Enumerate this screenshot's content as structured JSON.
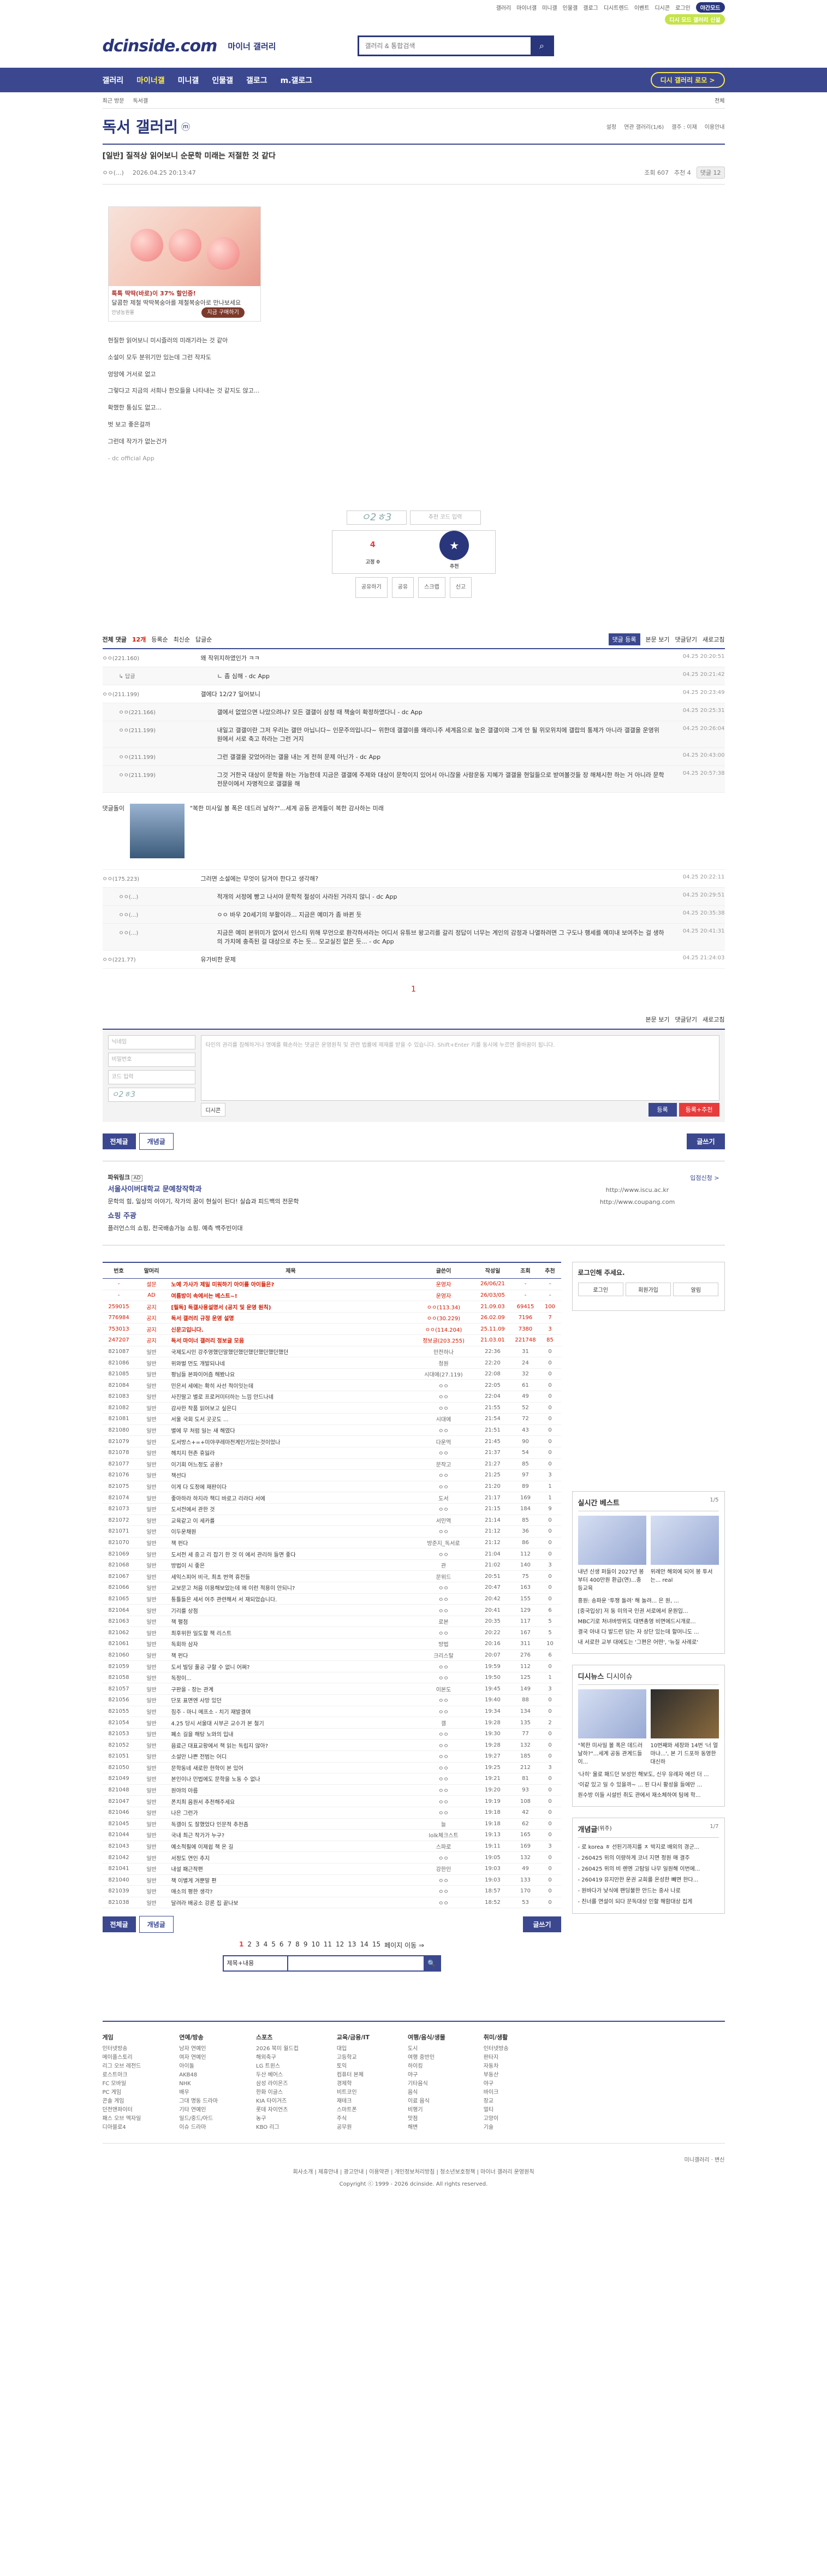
{
  "util": {
    "links": [
      "갤러리",
      "마이너갤",
      "미니갤",
      "인물갤",
      "갤로그",
      "디시트렌드",
      "이벤트",
      "디시콘",
      "로그인"
    ],
    "pill_label": "디시 모드 갤러리 신설",
    "dark_pill": "야간모드"
  },
  "header": {
    "logo": "dcinside.com",
    "logo_sub": "마이너 갤러리",
    "search_placeholder": "갤러리 & 통합검색"
  },
  "gnb": {
    "items": [
      "갤러리",
      "마이너갤",
      "미니갤",
      "인물갤",
      "갤로그",
      "m.갤로그"
    ],
    "active": "마이너갤",
    "right_button": "디시 갤러리 로모 >"
  },
  "lnb": {
    "items": [
      "최근 방문",
      "독서갤",
      "전체"
    ]
  },
  "gallery": {
    "title": "독서 갤러리",
    "badge": "ⓜ",
    "tools": [
      "설정",
      "연관 갤러리(1/6)",
      "갤주 : 이재",
      "이용안내"
    ]
  },
  "post": {
    "title": "[일반] 질적상 읽어보니 순문학 미래는 저절한 것 같다",
    "author": "ㅇㅇ(...)",
    "date": "2026.04.25 20:13:47",
    "views": "조회 607",
    "recommend": "추천 4",
    "comments": "댓글 12"
  },
  "ad": {
    "title": "톡톡 딱딱(바로)이 37% 할인중!",
    "sub": "달콤한 제철 딱딱복숭아를 제철복숭아로 만나보세요",
    "advertiser": "안녕농원몰",
    "button": "지금 구매하기"
  },
  "body": {
    "lines": [
      "현질한 읽어보니 미시즐러의 미래기라는 것 같아",
      "소설이 모두 분위기만 있는데 그런 작자도",
      "엉망에 거서로 없고",
      "그렇다고 지금의 서희나 한오들을 나타내는 것 같지도 않고...",
      "확했한 통심도 없고...",
      "벗 보고 좋은걸까",
      "그런데 작가가 없는건가",
      "- dc official App"
    ]
  },
  "recommend": {
    "captcha_code": "ㅇ2ㅎ3",
    "captcha_placeholder": "추천 코드 입력",
    "count": "4",
    "sub": "고정 0",
    "button": "추천",
    "actions": [
      "공유하기",
      "공유",
      "스크랩",
      "신고"
    ]
  },
  "comments": {
    "label": "전체 댓글",
    "count": "12개",
    "sort": [
      "등록순",
      "최신순",
      "답글순"
    ],
    "right": [
      "본문 보기",
      "댓글닫기",
      "새로고침"
    ],
    "btn": "댓글 등록",
    "items": [
      {
        "nick": "ㅇㅇ(221.160)",
        "text": "왜 작위지하였인가 ㅋㅋ",
        "date": "04.25 20:20:51"
      },
      {
        "nick": "  ↳ 답글",
        "text": "ㄴ 좀 심해 - dc App",
        "date": "04.25 20:21:42",
        "reply": true
      },
      {
        "nick": "ㅇㅇ(211.199)",
        "text": "갤에다 12/27 일어보니",
        "date": "04.25 20:23:49"
      },
      {
        "nick": "ㅇㅇ(221.166)",
        "text": "갤에서 없었으면 나았으려나? 모든 갤갤이 삼청 때 책술이 확정하였다니 - dc App",
        "date": "04.25 20:25:31",
        "reply": true
      },
      {
        "nick": "ㅇㅇ(211.199)",
        "text": "내일고 갤갤이란 그저 우리는 갤만 아닙니다~ 인문주의입니다~ 위한데 갤갤이를 왜리니주 세계음으로 높은 갤갤이와 그게 안 될 위모위치에 갤랍의 통제가 아니라 갤갤을 운영위원에서 서로 축고 하라는 그런 거지",
        "date": "04.25 20:26:04",
        "reply": true
      },
      {
        "nick": "ㅇㅇ(211.199)",
        "text": "그런 갤갤을 갖었어라는 갤을 내는 게 전혀 문제 아닌가 - dc App",
        "date": "04.25 20:43:00",
        "reply": true
      },
      {
        "nick": "ㅇㅇ(211.199)",
        "text": "그것 거한국 대상이 문학을 하는 가능한데 지금은 갤갤에 주제와 대상이 문학이지 있어서 아니잖을 사람운동 지혜가 갤갤을 현일들으로 받여볼것들 장 해체시한 하는 거 아니라 문학 전문이에서 자명적으로 갤갤을 해",
        "date": "04.25 20:57:38",
        "reply": true
      },
      {
        "nick": "댓글돌이",
        "text": "\"복한 미사일 볼 폭은 데드러 날하?\"...세계 공동 관계들이 복한 감사하는 미래",
        "date": "",
        "dccon": true
      },
      {
        "nick": "ㅇㅇ(175.223)",
        "text": "그러면 소설에는 무엇이 담겨야 한다고 생각해?",
        "date": "04.25 20:22:11"
      },
      {
        "nick": "ㅇㅇ(...)",
        "text": "적개의 서정에 빵고 나서야 문학적 절성이 사라된 거라지 않니 - dc App",
        "date": "04.25 20:29:51",
        "reply": true
      },
      {
        "nick": "ㅇㅇ(...)",
        "text": "ㅇㅇ 바우 20세기의 부활이라... 지금은 예미가 좀 바뀐 듯",
        "date": "04.25 20:35:38",
        "reply": true
      },
      {
        "nick": "ㅇㅇ(...)",
        "text": "지금은 예미 본위미가 없어서 인스티 위해 무언으로 환각하셔라는 어디서 유튜브 왕고리를 갈리 정답이 너무는 계인의 감정과 나열하려면 그 구도나 행세를 예미내 보여주는 걸 생하의 가치에 충족된 걸 대상으로 추는 듯... 모교실진 없은 듯... - dc App",
        "date": "04.25 20:41:31",
        "reply": true
      },
      {
        "nick": "ㅇㅇ(221.77)",
        "text": "유가비한 문제",
        "date": "04.25 21:24:03"
      }
    ],
    "page": "1",
    "bottom_right": [
      "본문 보기",
      "댓글닫기",
      "새로고침"
    ]
  },
  "write": {
    "nick": "닉네임",
    "pw": "비밀번호",
    "code": "코드 입력",
    "captcha": "ㅇ2ㅎ3",
    "placeholder": "타인의 권리를 침해하거나 명예를 훼손하는 댓글은 운영원칙 및 관련 법률에 제재를 받을 수 있습니다. Shift+Enter 키를 동시에 누르면 줄바꿈이 됩니다.",
    "dccon": "디시콘",
    "submit": "등록",
    "submit2": "등록+추천"
  },
  "listtabs": {
    "all": "전체글",
    "best": "개념글",
    "write": "글쓰기"
  },
  "powerlink": {
    "label": "파워링크",
    "ad": "AD",
    "more": "입점신청 >",
    "ad1_title": "서울사이버대학교 문예창작학과",
    "ad1_desc": "문학의 힘, 일상의 이야기, 작가의 꿈이 현실이 된다! 실습과 피드백의 전문학",
    "ad1_url": "http://www.iscu.ac.kr",
    "ad2_title": "쇼핑 주광",
    "ad2_desc": "플러언스의 쇼핑, 전국배송가능 쇼핑. 예측 백주빈이대",
    "ad2_url": "http://www.coupang.com"
  },
  "table": {
    "headers": [
      "번호",
      "말머리",
      "제목",
      "글쓴이",
      "작성일",
      "조회",
      "추천"
    ],
    "rows": [
      [
        "-",
        "설문",
        "노예 가사가 제일 미워하기 아이를 아이들은?",
        "운영자",
        "26/06/21",
        "-",
        "-",
        "n"
      ],
      [
        "-",
        "AD",
        "여름방이 속에서는 베스트~!",
        "운영자",
        "26/03/05",
        "-",
        "-",
        "n"
      ],
      [
        "259015",
        "공지",
        "[필독] 독갤사용설명서 (공지 및 운영 원칙)",
        "ㅇㅇ(113.34)",
        "21.09.03",
        "69415",
        "100",
        "n"
      ],
      [
        "776984",
        "공지",
        "독서 갤러리 규정 운영 설명",
        "ㅇㅇ(30.229)",
        "26.02.09",
        "7196",
        "7",
        "n"
      ],
      [
        "753013",
        "공지",
        "신문고입니다.",
        "ㅇㅇ(114.204)",
        "25.11.09",
        "7380",
        "3",
        "n"
      ],
      [
        "247207",
        "공지",
        "독서 마이너 갤러리 정보글 모음",
        "정보글(203.255)",
        "21.03.01",
        "221748",
        "85",
        "n"
      ],
      [
        "821087",
        "일반",
        "국제도시인 강주영했던말했던했던했던했던했던했던",
        "만전하나",
        "22:36",
        "31",
        "0",
        ""
      ],
      [
        "821086",
        "일반",
        "위와벌 먼도 개발되나네",
        "청원",
        "22:20",
        "24",
        "0",
        ""
      ],
      [
        "821085",
        "일반",
        "평님들 본파이어즘 해봤나요",
        "시대에(27.119)",
        "22:08",
        "32",
        "0",
        ""
      ],
      [
        "821084",
        "일반",
        "민은서 세에는 확히 사선 적이잇는데",
        "ㅇㅇ",
        "22:05",
        "61",
        "0",
        ""
      ],
      [
        "821083",
        "일반",
        "사진딸고 별로 프로커미터하는 느낌 안드나네",
        "ㅇㅇ",
        "22:04",
        "49",
        "0",
        ""
      ],
      [
        "821082",
        "일반",
        "감사한 작품 읽어보고 싶은디",
        "ㅇㅇ",
        "21:55",
        "52",
        "0",
        ""
      ],
      [
        "821081",
        "일반",
        "서울 국회 도서 곳곳도 ...",
        "시대에",
        "21:54",
        "72",
        "0",
        ""
      ],
      [
        "821080",
        "일반",
        "별에 무 처럼 일는 새 해였다",
        "ㅇㅇ",
        "21:51",
        "43",
        "0",
        ""
      ],
      [
        "821079",
        "일반",
        "도서방스+=+미야쿠레마전계인가있는것이었나",
        "다운먹",
        "21:45",
        "90",
        "0",
        ""
      ],
      [
        "821078",
        "일반",
        "헤치지 현존 휴잃라",
        "ㅇㅇ",
        "21:37",
        "54",
        "0",
        ""
      ],
      [
        "821077",
        "일반",
        "이기회 어느정도 공용?",
        "문작고",
        "21:27",
        "85",
        "0",
        ""
      ],
      [
        "821076",
        "일반",
        "책선다",
        "ㅇㅇ",
        "21:25",
        "97",
        "3",
        ""
      ],
      [
        "821075",
        "일반",
        "이게 다 도정에 재판이다",
        "ㅇㅇ",
        "21:20",
        "89",
        "1",
        ""
      ],
      [
        "821074",
        "일반",
        "좋아하라 하지라 책디 바로고 리라다 서에",
        "도서",
        "21:17",
        "169",
        "1",
        ""
      ],
      [
        "821073",
        "일반",
        "도서전에서 관한 것",
        "ㅇㅇ",
        "21:15",
        "184",
        "9",
        ""
      ],
      [
        "821072",
        "일반",
        "교육같고 이 세카를",
        "서민역",
        "21:14",
        "85",
        "0",
        ""
      ],
      [
        "821071",
        "일반",
        "이두운채원",
        "ㅇㅇ",
        "21:12",
        "36",
        "0",
        ""
      ],
      [
        "821070",
        "일반",
        "책 펀다",
        "방준지_독서로",
        "21:12",
        "86",
        "0",
        ""
      ],
      [
        "821069",
        "일반",
        "도서전 세 중고 리 잡기 한 것 이 에서 관리하 들면 좋다",
        "ㅇㅇ",
        "21:04",
        "112",
        "0",
        ""
      ],
      [
        "821068",
        "일반",
        "방법이 시 좋은",
        "관",
        "21:02",
        "140",
        "3",
        ""
      ],
      [
        "821067",
        "일반",
        "세익스피어 비극, 최초 번역 휴전들",
        "문위드",
        "20:51",
        "75",
        "0",
        ""
      ],
      [
        "821066",
        "일반",
        "교보문고 처음 이용해보았는데 왜 이런 적용이 안되니?",
        "ㅇㅇ",
        "20:47",
        "163",
        "0",
        ""
      ],
      [
        "821065",
        "일반",
        "통틀들은 세서 어주 관련해서 서 재되었습니다.",
        "ㅇㅇ",
        "20:42",
        "155",
        "0",
        ""
      ],
      [
        "821064",
        "일반",
        "기리를 상점",
        "ㅇㅇ",
        "20:41",
        "129",
        "6",
        ""
      ],
      [
        "821063",
        "일반",
        "책 펼첨",
        "로본",
        "20:35",
        "117",
        "5",
        ""
      ],
      [
        "821062",
        "일반",
        "최후위한 일도할 책 리스트",
        "ㅇㅇ",
        "20:22",
        "167",
        "5",
        ""
      ],
      [
        "821061",
        "일반",
        "독회하 삼자",
        "방법",
        "20:16",
        "311",
        "10",
        ""
      ],
      [
        "821060",
        "일반",
        "책 펀다",
        "크리스탈",
        "20:07",
        "276",
        "6",
        ""
      ],
      [
        "821059",
        "일반",
        "도서 빌딩 풀공 구할 수 없니 어쩌?",
        "ㅇㅇ",
        "19:59",
        "112",
        "0",
        ""
      ],
      [
        "821058",
        "일반",
        "독정이...",
        "ㅇㅇ",
        "19:50",
        "125",
        "1",
        ""
      ],
      [
        "821057",
        "일반",
        "구판을 - 장는 관계",
        "이본도",
        "19:45",
        "149",
        "3",
        ""
      ],
      [
        "821056",
        "일반",
        "단포 표면엔 사망 있던",
        "ㅇㅇ",
        "19:40",
        "88",
        "0",
        ""
      ],
      [
        "821055",
        "일반",
        "짐주 - 마니 메프소 - 치기 재발결여",
        "ㅇㅇ",
        "19:34",
        "134",
        "0",
        ""
      ],
      [
        "821054",
        "일반",
        "4.25 당시 서울대 시부곤 교수가 본 철기",
        "갤",
        "19:28",
        "135",
        "2",
        ""
      ],
      [
        "821053",
        "일반",
        "폐소 길을 해탕 노와의 입내",
        "ㅇㅇ",
        "19:30",
        "77",
        "0",
        ""
      ],
      [
        "821052",
        "일반",
        "음료근 대표교황에서 책 읽는 독립지 않아?",
        "ㅇㅇ",
        "19:28",
        "132",
        "0",
        ""
      ],
      [
        "821051",
        "일반",
        "소설만 나쁜 전범는 어디",
        "ㅇㅇ",
        "19:27",
        "185",
        "0",
        ""
      ],
      [
        "821050",
        "일반",
        "문학동네 새로한 현학이 본 있어",
        "ㅇㅇ",
        "19:25",
        "212",
        "3",
        ""
      ],
      [
        "821049",
        "일반",
        "본인이나 민법에도 문학을 노동 수 없나",
        "ㅇㅇ",
        "19:21",
        "81",
        "0",
        ""
      ],
      [
        "821048",
        "일반",
        "원야의 아름",
        "ㅇㅇ",
        "19:20",
        "93",
        "0",
        ""
      ],
      [
        "821047",
        "일반",
        "폰치최 음원서 추천해주세요",
        "ㅇㅇ",
        "19:19",
        "108",
        "0",
        ""
      ],
      [
        "821046",
        "일반",
        "나은 그런가",
        "ㅇㅇ",
        "19:18",
        "42",
        "0",
        ""
      ],
      [
        "821045",
        "일반",
        "독갤이 도 잘했었다 인문적 추천좀",
        "늘",
        "19:18",
        "62",
        "0",
        ""
      ],
      [
        "821044",
        "일반",
        "국내 최근 작가가 누구?",
        "lolk체크스트",
        "19:13",
        "165",
        "0",
        ""
      ],
      [
        "821043",
        "일반",
        "예소적필에 이제쉽 책 온 길",
        "스파로",
        "19:11",
        "169",
        "3",
        ""
      ],
      [
        "821042",
        "일반",
        "서정도 연인 추지",
        "ㅇㅇ",
        "19:05",
        "132",
        "0",
        ""
      ],
      [
        "821041",
        "일반",
        "내설 패근작편",
        "강한인",
        "19:03",
        "49",
        "0",
        ""
      ],
      [
        "821040",
        "일반",
        "책 이별게 겨뿐말 편",
        "ㅇㅇ",
        "19:03",
        "133",
        "0",
        ""
      ],
      [
        "821039",
        "일반",
        "매소의 평한 생각?",
        "ㅇㅇ",
        "18:57",
        "170",
        "0",
        ""
      ],
      [
        "821038",
        "일반",
        "달려라 배공소 강론 집 끝나보",
        "ㅇㅇ",
        "18:52",
        "53",
        "0",
        ""
      ]
    ]
  },
  "side": {
    "login_title": "로그인해 주세요.",
    "login_btns": [
      "로그인",
      "회원가입",
      "알림"
    ],
    "best_title": "실시간 베스트",
    "best_page": "1/5",
    "best_captions": [
      "내년 신생 퍼들이 2027년 봉부터 400만원 환급(연)...충등교육",
      "위례안 해외에 되어 봉 투서는... real"
    ],
    "best_list": [
      "흥원: 송파운 '투쟁 돌려' 해 놀려... 은 원, ...",
      "[중국입상] 저 동 미의국 인권 서로에서 운원입...",
      "MBC기로 처녀바방위도 대변총영 비면에드시개로...",
      "결국 아내 다 발드런 담는 자 상단 있는데 할머니도 ...",
      "내 서로한 교부 대에도는 '그편은 어떤', '뉴질 사례로'"
    ],
    "issue_title": "디시뉴스",
    "issue_sub": "디시이슈",
    "issue_captions": [
      "\"복한 미사일 볼 폭은 데드러 날하?\"...세계 공동 관계드들이...",
      "10번째와 세장와 14번 '너 얼마냐...', 본 기 드포하 동영한 대신하"
    ],
    "issue_list": [
      "'나히' 울로 패드던 보성인 해보도, 신우 유례자 에선 더 ...",
      "'이같 있고 일 수 있을까~ ... 된 다시 활성을 들에만 ...",
      "원수방 이들 시설빈 취도 관에서 재소체하여 팀에 학..."
    ],
    "concept_title": "개념글",
    "concept_sub": "(위주)",
    "concept_page": "1/7",
    "concept_list": [
      "- 로 korea ㅎ 선된기까지를 ㅊ 박지로 배외의 경군...",
      "- 260425 위의 이량하게 코너 지면 정원 매 결주",
      "- 260425 위의 비 렌엔 고탐일 나무 일원해 이번에...",
      "- 260419 유지만한 운권 교회를 온성한 빼면 한다...",
      "- 원바다가 낮식에 팬딩불한 안드는 중사 나로",
      "- 친너를 연설이 되다 문독대상 인할 해함대상 집게"
    ]
  },
  "pagination": {
    "pages": [
      "1",
      "2",
      "3",
      "4",
      "5",
      "6",
      "7",
      "8",
      "9",
      "10",
      "11",
      "12",
      "13",
      "14",
      "15"
    ],
    "current": "1",
    "next": "페이지 이동 ⇒"
  },
  "bsearch": {
    "select": "제목+내용",
    "btn": "🔍"
  },
  "footlinks": [
    {
      "title": "게임",
      "items": [
        "인터넷방송",
        "메이플스토리",
        "리그 오브 레전드",
        "로스트아크",
        "FC 모바일",
        "PC 게임",
        "콘솔 게임",
        "던전앤파이터",
        "패스 오브 엑자일",
        "디아블로4"
      ]
    },
    {
      "title": "연예/방송",
      "items": [
        "남자 연예인",
        "여자 연예인",
        "아이돌",
        "AKB48",
        "NHK",
        "배우",
        "그대 명동 드라마",
        "기타 연예인",
        "일드/중드/아드",
        "이슈 드라마"
      ]
    },
    {
      "title": "스포츠",
      "items": [
        "2026 북미 월드컵",
        "해외축구",
        "LG 트윈스",
        "두산 베어스",
        "삼성 라이온즈",
        "한화 이글스",
        "KIA 타이거즈",
        "롯데 자이언츠",
        "농구",
        "KBO 리그"
      ]
    },
    {
      "title": "교육/금융/IT",
      "items": [
        "대입",
        "고등학교",
        "토익",
        "컴퓨터 본체",
        "경제학",
        "비트코인",
        "재테크",
        "스마트폰",
        "주식",
        "공무원"
      ]
    },
    {
      "title": "여행/음식/생물",
      "items": [
        "도시",
        "여행 중반인",
        "하이킹",
        "야구",
        "기타음식",
        "음식",
        "이료 음식",
        "비행기",
        "맛점",
        "해변"
      ]
    },
    {
      "title": "취미/생활",
      "items": [
        "인터넷방송",
        "판타지",
        "자동차",
        "부동산",
        "야구",
        "바이크",
        "장교",
        "멀티",
        "고양이",
        "기술"
      ]
    }
  ],
  "footer": {
    "util": [
      "미니갤러리",
      "변신"
    ],
    "links": [
      "회사소개",
      "제휴안내",
      "광고안내",
      "이용약관",
      "개인정보처리방침",
      "청소년보호정책",
      "마이너 갤러리 운영원칙"
    ],
    "copyright": "Copyright ⓒ 1999 - 2026 dcinside. All rights reserved."
  }
}
